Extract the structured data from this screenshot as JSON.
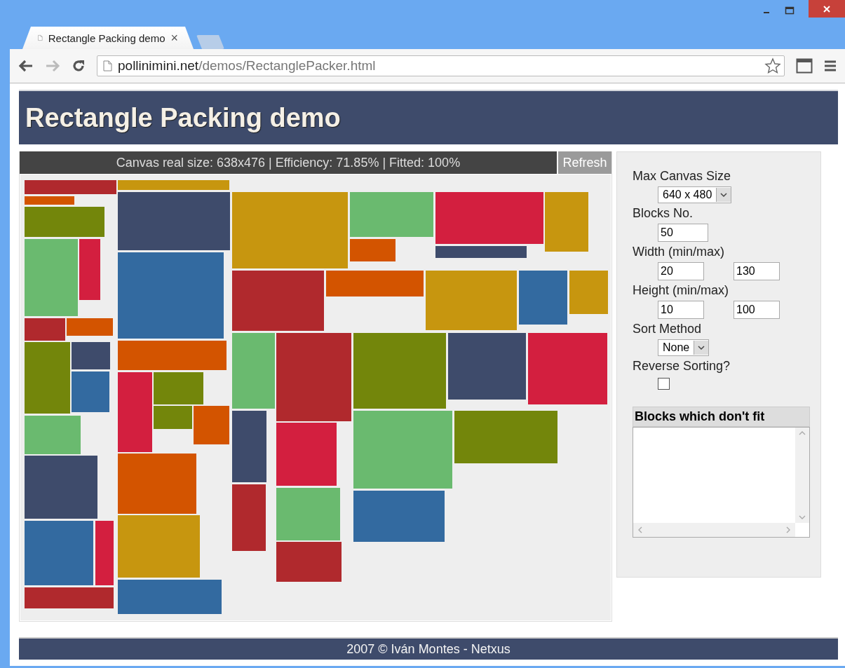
{
  "browser": {
    "tab": {
      "title": "Rectangle Packing demo",
      "close": "×"
    },
    "url": {
      "host": "pollinimini.net",
      "path": "/demos/RectanglePacker.html"
    }
  },
  "page": {
    "title": "Rectangle Packing demo",
    "status": "Canvas real size: 638x476 | Efficiency: 71.85% | Fitted: 100%",
    "refresh_button": "Refresh",
    "settings": [
      {
        "kind": "select",
        "label": "Max Canvas Size",
        "values": [
          "640 x 480"
        ]
      },
      {
        "kind": "input",
        "label": "Blocks No.",
        "values": [
          "50"
        ]
      },
      {
        "kind": "input",
        "label": "Width (min/max)",
        "values": [
          "20",
          "130"
        ]
      },
      {
        "kind": "input",
        "label": "Height (min/max)",
        "values": [
          "10",
          "100"
        ]
      },
      {
        "kind": "select",
        "label": "Sort Method",
        "values": [
          "None"
        ]
      },
      {
        "kind": "checkbox",
        "label": "Reverse Sorting?",
        "checked": false
      }
    ],
    "unfit_blocks": {
      "heading": "Blocks which don't fit"
    },
    "footer": "2007 © Iván Montes - Netxus"
  }
}
